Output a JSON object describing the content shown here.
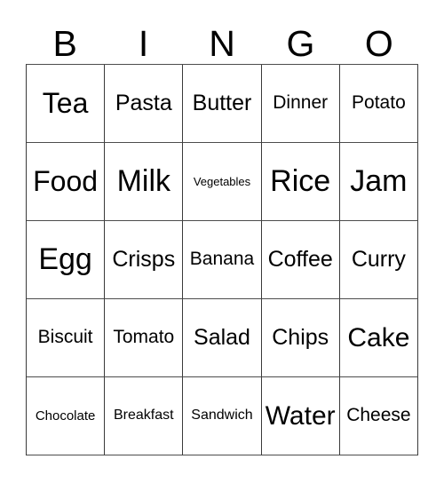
{
  "card": {
    "header_letters": [
      "B",
      "I",
      "N",
      "G",
      "O"
    ],
    "grid_rows": [
      [
        {
          "label": "Tea",
          "size": "fs-xl"
        },
        {
          "label": "Pasta",
          "size": "fs-m"
        },
        {
          "label": "Butter",
          "size": "fs-m"
        },
        {
          "label": "Dinner",
          "size": "fs-s"
        },
        {
          "label": "Potato",
          "size": "fs-s"
        }
      ],
      [
        {
          "label": "Food",
          "size": "fs-xl"
        },
        {
          "label": "Milk",
          "size": "fs-xxl"
        },
        {
          "label": "Vegetables",
          "size": "fs-tiny"
        },
        {
          "label": "Rice",
          "size": "fs-xxl"
        },
        {
          "label": "Jam",
          "size": "fs-xxl"
        }
      ],
      [
        {
          "label": "Egg",
          "size": "fs-xxl"
        },
        {
          "label": "Crisps",
          "size": "fs-m"
        },
        {
          "label": "Banana",
          "size": "fs-s"
        },
        {
          "label": "Coffee",
          "size": "fs-m"
        },
        {
          "label": "Curry",
          "size": "fs-m"
        }
      ],
      [
        {
          "label": "Biscuit",
          "size": "fs-s"
        },
        {
          "label": "Tomato",
          "size": "fs-s"
        },
        {
          "label": "Salad",
          "size": "fs-m"
        },
        {
          "label": "Chips",
          "size": "fs-m"
        },
        {
          "label": "Cake",
          "size": "fs-l"
        }
      ],
      [
        {
          "label": "Chocolate",
          "size": "fs-xxs"
        },
        {
          "label": "Breakfast",
          "size": "fs-xs"
        },
        {
          "label": "Sandwich",
          "size": "fs-xs"
        },
        {
          "label": "Water",
          "size": "fs-l"
        },
        {
          "label": "Cheese",
          "size": "fs-s"
        }
      ]
    ],
    "colors": {
      "background": "#ffffff",
      "text": "#000000",
      "grid_line": "#3a3a3a"
    }
  }
}
